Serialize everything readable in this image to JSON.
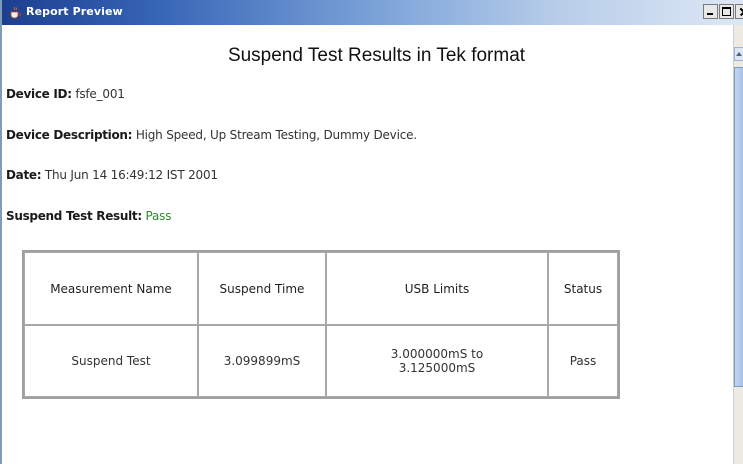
{
  "window": {
    "title": "Report Preview",
    "icon": "java-cup-icon"
  },
  "report": {
    "title": "Suspend Test Results in Tek format",
    "device_id_label": "Device ID:",
    "device_id_value": "fsfe_001",
    "device_desc_label": "Device Description:",
    "device_desc_value": "High Speed, Up Stream Testing, Dummy Device.",
    "date_label": "Date:",
    "date_value": "Thu Jun 14 16:49:12 IST 2001",
    "result_label": "Suspend Test Result:",
    "result_value": "Pass",
    "pass_color": "#2e8b2e"
  },
  "table": {
    "headers": [
      "Measurement Name",
      "Suspend Time",
      "USB Limits",
      "Status"
    ],
    "rows": [
      {
        "name": "Suspend Test",
        "time": "3.099899mS",
        "limits_line1": "3.000000mS to",
        "limits_line2": "3.125000mS",
        "status": "Pass"
      }
    ]
  }
}
